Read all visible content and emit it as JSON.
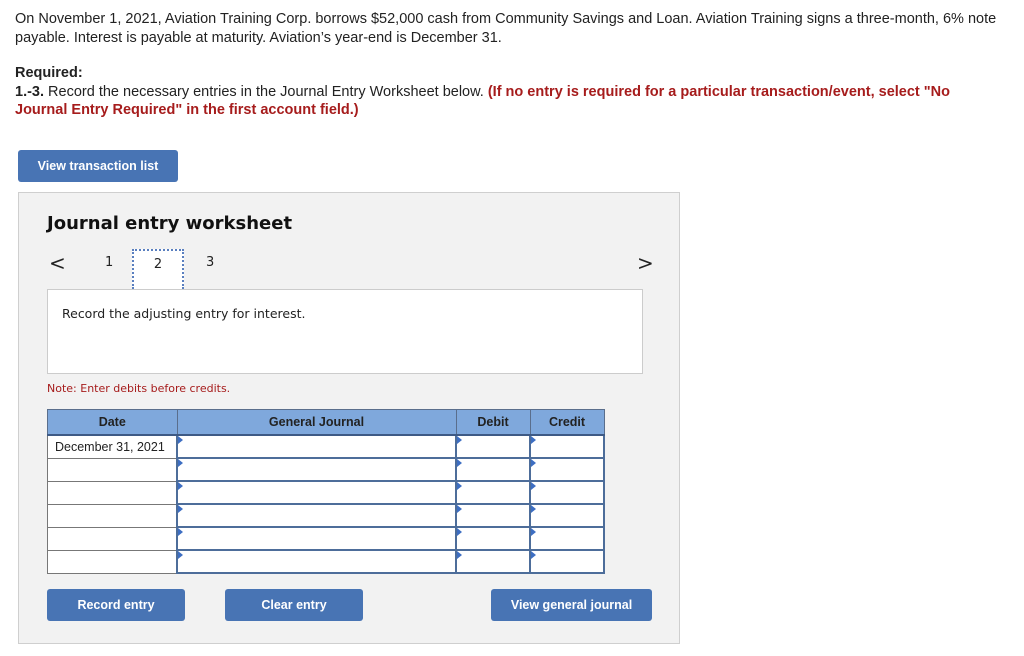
{
  "problem": {
    "intro": "On November 1, 2021, Aviation Training Corp. borrows $52,000 cash from Community Savings and Loan. Aviation Training signs a three-month, 6% note payable. Interest is payable at maturity. Aviation’s year-end is December 31.",
    "required_label": "Required:",
    "instruction_number": "1.-3.",
    "instruction_text": " Record the necessary entries in the Journal Entry Worksheet below. ",
    "instruction_red": "(If no entry is required for a particular transaction/event, select \"No Journal Entry Required\" in the first account field.)"
  },
  "buttons": {
    "view_transaction_list": "View transaction list",
    "record_entry": "Record entry",
    "clear_entry": "Clear entry",
    "view_general_journal": "View general journal"
  },
  "worksheet": {
    "title": "Journal entry worksheet",
    "prev_icon": "chevron-left-icon",
    "next_icon": "chevron-right-icon",
    "prev_glyph": "<",
    "next_glyph": ">",
    "steps": [
      "1",
      "2",
      "3"
    ],
    "active_step": "2",
    "description": "Record the adjusting entry for interest.",
    "note": "Note: Enter debits before credits."
  },
  "table": {
    "headers": [
      "Date",
      "General Journal",
      "Debit",
      "Credit"
    ],
    "rows": [
      {
        "date": "December 31, 2021",
        "account": "",
        "debit": "",
        "credit": ""
      },
      {
        "date": "",
        "account": "",
        "debit": "",
        "credit": ""
      },
      {
        "date": "",
        "account": "",
        "debit": "",
        "credit": ""
      },
      {
        "date": "",
        "account": "",
        "debit": "",
        "credit": ""
      },
      {
        "date": "",
        "account": "",
        "debit": "",
        "credit": ""
      },
      {
        "date": "",
        "account": "",
        "debit": "",
        "credit": ""
      }
    ]
  },
  "colors": {
    "button_blue": "#4874b4",
    "header_blue": "#7fa8dc",
    "instruction_red": "#a61c1c"
  }
}
